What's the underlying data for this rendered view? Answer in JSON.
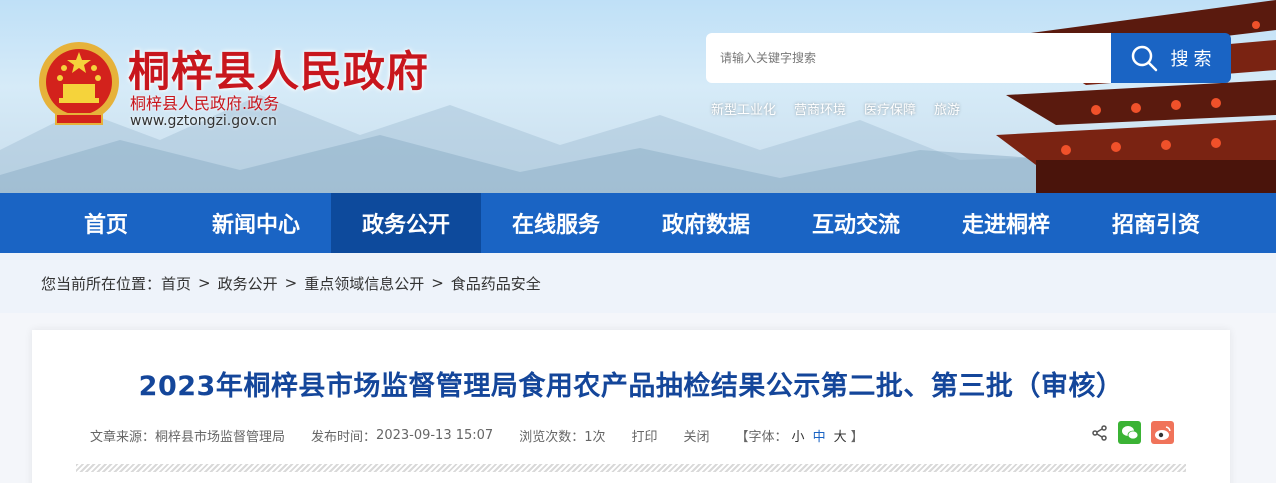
{
  "header": {
    "site_title": "桐梓县人民政府",
    "site_subtitle": "桐梓县人民政府.政务",
    "site_url": "www.gztongzi.gov.cn",
    "search_placeholder": "请输入关键字搜索",
    "search_button": "搜 索",
    "hot_words": [
      "新型工业化",
      "营商环境",
      "医疗保障",
      "旅游"
    ]
  },
  "nav": {
    "items": [
      "首页",
      "新闻中心",
      "政务公开",
      "在线服务",
      "政府数据",
      "互动交流",
      "走进桐梓",
      "招商引资"
    ],
    "active": "政务公开"
  },
  "breadcrumb": {
    "prefix": "您当前所在位置：",
    "items": [
      "首页",
      "政务公开",
      "重点领域信息公开",
      "食品药品安全"
    ],
    "separator": ">"
  },
  "article": {
    "title": "2023年桐梓县市场监督管理局食用农产品抽检结果公示第二批、第三批（审核）",
    "source_label": "文章来源：",
    "source": "桐梓县市场监督管理局",
    "date_label": "发布时间：",
    "date": "2023-09-13 15:07",
    "views_label": "浏览次数：",
    "views": "1次",
    "print": "打印",
    "close": "关闭",
    "font_label": "【字体：",
    "font_small": "小",
    "font_medium": "中",
    "font_large": "大",
    "font_end": "】"
  },
  "colors": {
    "brand_blue": "#1a64c4",
    "active_nav": "#0d4a9c",
    "title_red": "#c8161d",
    "article_title": "#14469a"
  }
}
